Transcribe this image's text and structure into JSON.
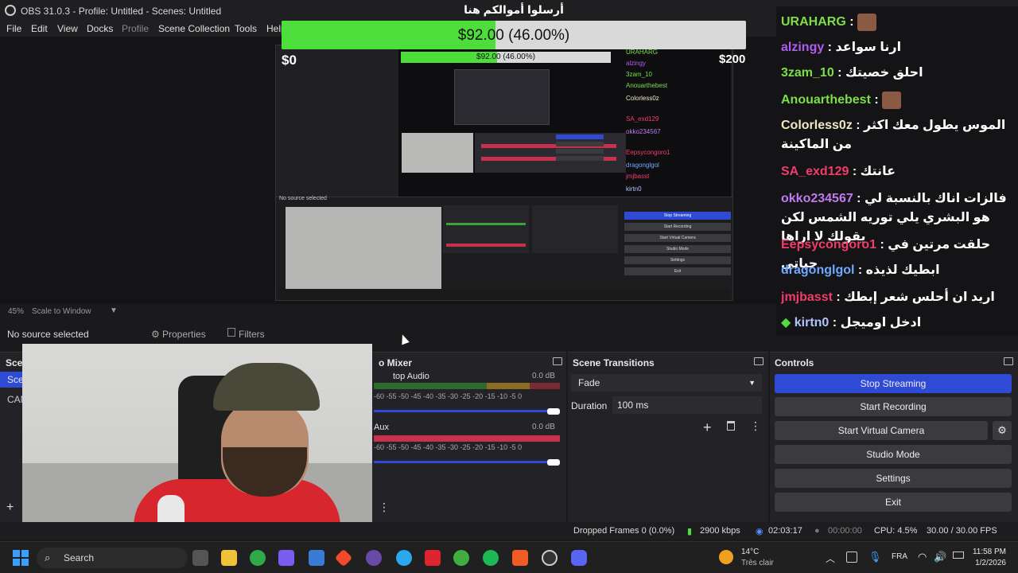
{
  "window": {
    "title": "OBS 31.0.3 - Profile: Untitled - Scenes: Untitled"
  },
  "menu": [
    "File",
    "Edit",
    "View",
    "Docks",
    "Profile",
    "Scene Collection",
    "Tools",
    "Help"
  ],
  "donation": {
    "heading": "أرسلوا أموالكم هنا",
    "progress_text": "$92.00 (46.00%)",
    "progress_fraction": 0.46,
    "min_label": "$0",
    "max_label": "$200",
    "bar_color": "#4dde3b"
  },
  "chat": [
    {
      "user": "URAHARG",
      "sep": " :",
      "message": "",
      "color": "#7dde4a",
      "emote": true
    },
    {
      "user": "alzingy",
      "sep": " :",
      "message": " ارنا سواعد",
      "color": "#b05cf0",
      "emote": false
    },
    {
      "user": "3zam_10",
      "sep": " :",
      "message": " احلق خصيتك",
      "color": "#7dde4a",
      "emote": false
    },
    {
      "user": "Anouarthebest",
      "sep": " :",
      "message": "",
      "color": "#7dde4a",
      "emote": true
    },
    {
      "user": "Colorless0z",
      "sep": " :",
      "message": " الموس يطول معك اكثر من الماكينة",
      "color": "#f0e8c0",
      "emote": false
    },
    {
      "user": "SA_exd129",
      "sep": " :",
      "message": " عانتك",
      "color": "#f03c6a",
      "emote": false
    },
    {
      "user": "okko234567",
      "sep": " :",
      "message": " فالزات اناك بالنسبة لي هو البشري يلي توريه الشمس لكن يقولك لا اراها",
      "color": "#c07af0",
      "emote": false
    },
    {
      "user": "Eepsycongoro1",
      "sep": " :",
      "message": " حلقت مرتين في حياتي",
      "color": "#f03c6a",
      "emote": false
    },
    {
      "user": "dragonglgol",
      "sep": " :",
      "message": " ابطيك لذيذه",
      "color": "#6fa8ff",
      "emote": false
    },
    {
      "user": "jmjbasst",
      "sep": " :",
      "message": " اريد ان أحلس شعر إبطك",
      "color": "#f03c6a",
      "emote": false
    },
    {
      "user": "kirtn0",
      "sep": " :",
      "message": " ادخل اوميجل",
      "color": "#b0c4ff",
      "emote": false,
      "badge": true
    }
  ],
  "zoom": {
    "percent": "45%",
    "mode": "Scale to Window"
  },
  "source_bar": {
    "no_source": "No source selected",
    "properties": "Properties",
    "filters": "Filters"
  },
  "docks": {
    "scenes": {
      "title": "Sce",
      "items": [
        "Sce",
        "CAM"
      ]
    },
    "mixer": {
      "title": "o Mixer",
      "channels": [
        {
          "name": "top Audio",
          "db": "0.0 dB"
        },
        {
          "name": "Aux",
          "db": "0.0 dB"
        }
      ],
      "ticks": "-60  -55  -50  -45  -40  -35  -30  -25  -20  -15  -10  -5  0"
    },
    "transitions": {
      "title": "Scene Transitions",
      "selected": "Fade",
      "duration_label": "Duration",
      "duration_value": "100 ms"
    },
    "controls": {
      "title": "Controls",
      "buttons": [
        "Stop Streaming",
        "Start Recording",
        "Start Virtual Camera",
        "Studio Mode",
        "Settings",
        "Exit"
      ]
    }
  },
  "status": {
    "dropped": "Dropped Frames 0 (0.0%)",
    "bitrate": "2900 kbps",
    "stream_time": "02:03:17",
    "rec_time": "00:00:00",
    "cpu": "CPU: 4.5%",
    "fps": "30.00 / 30.00 FPS"
  },
  "taskbar": {
    "search": "Search",
    "weather_temp": "14°C",
    "weather_desc": "Très clair",
    "lang": "FRA",
    "time": "11:58 PM",
    "date": "1/2/2026"
  },
  "nested": {
    "no_source": "No source selected",
    "controls": [
      "Stop Streaming",
      "Start Recording",
      "Start Virtual Camera",
      "Studio Mode",
      "Settings",
      "Exit"
    ],
    "chat_users": [
      "URAHARG",
      "alzingy",
      "3zam_10",
      "Anouarthebest",
      "Colorless0z",
      "SA_exd129",
      "okko234567",
      "Eepsycongoro1",
      "dragonglgol",
      "jmjbasst",
      "kirtn0"
    ]
  }
}
